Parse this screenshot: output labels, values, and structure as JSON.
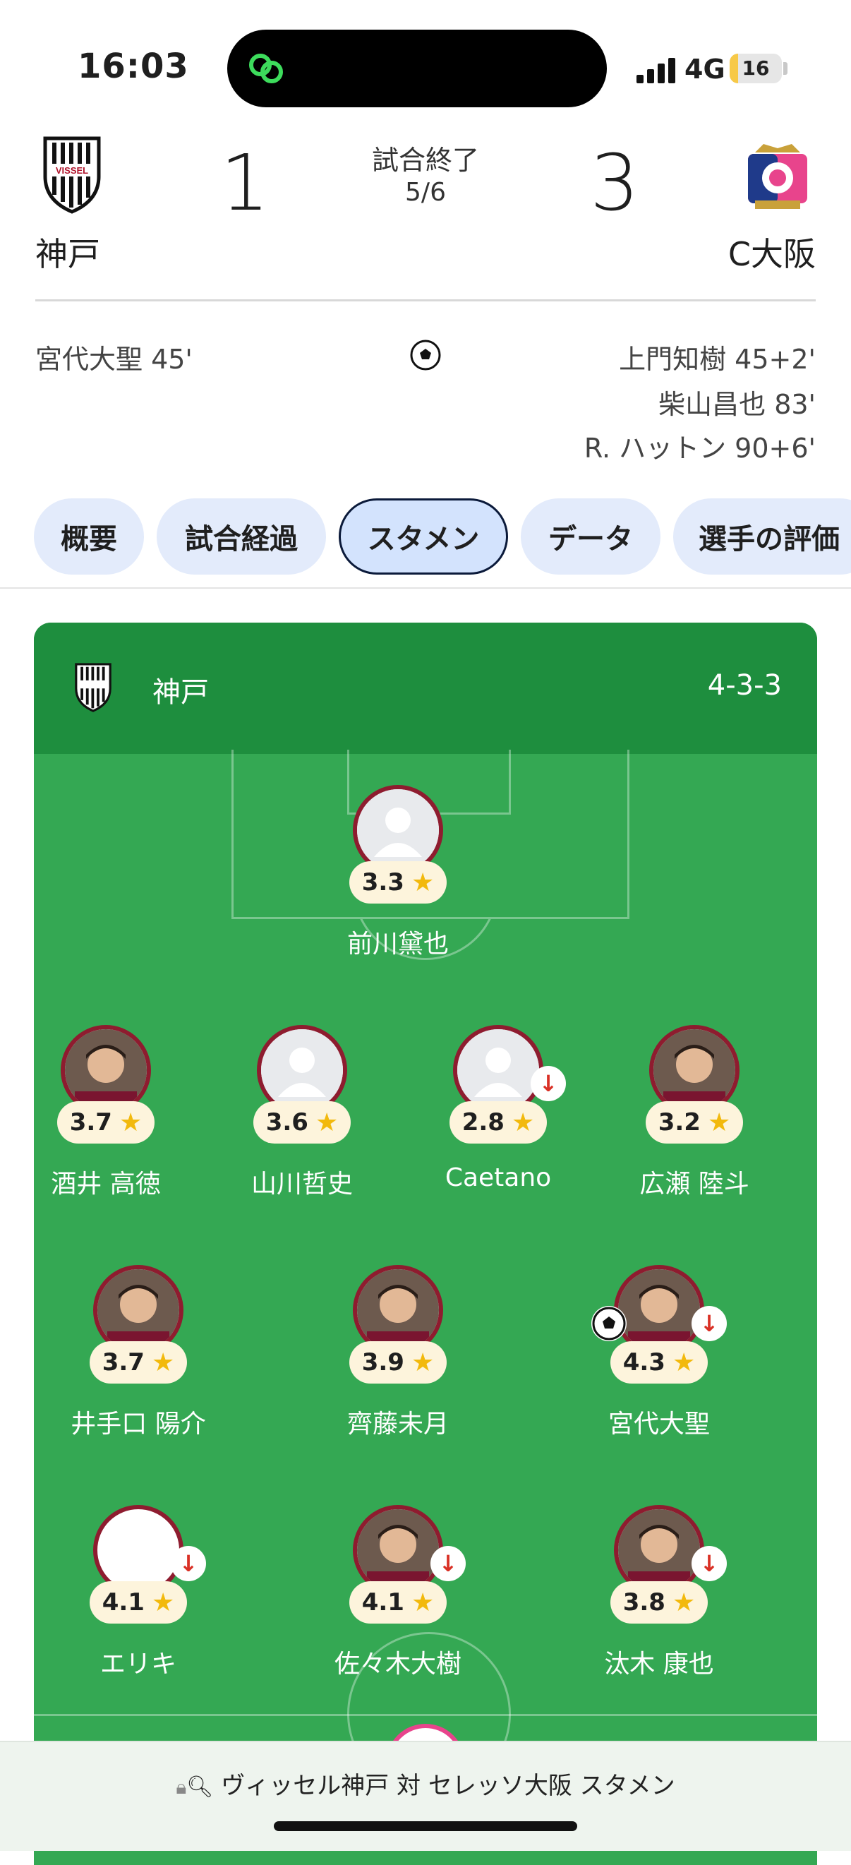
{
  "status_bar": {
    "time": "16:03",
    "network": "4G",
    "battery": "16",
    "battery_level": 0.16
  },
  "match": {
    "home": {
      "name": "神戸",
      "score": "1",
      "crest_text": "VISSEL"
    },
    "away": {
      "name": "C大阪",
      "score": "3"
    },
    "status": "試合終了",
    "date": "5/6",
    "home_scorers": [
      "宮代大聖 45'"
    ],
    "away_scorers": [
      "上門知樹 45+2'",
      "柴山昌也 83'",
      "R. ハットン 90+6'"
    ]
  },
  "tabs": [
    {
      "label": "概要",
      "active": false
    },
    {
      "label": "試合経過",
      "active": false
    },
    {
      "label": "スタメン",
      "active": true
    },
    {
      "label": "データ",
      "active": false
    },
    {
      "label": "選手の評価",
      "active": false
    }
  ],
  "lineup": {
    "team": "神戸",
    "formation": "4-3-3",
    "players": [
      {
        "name": "前川黛也",
        "rating": "3.3",
        "photo": "placeholder",
        "sub": false,
        "goal": false
      },
      {
        "name": "酒井 高徳",
        "rating": "3.7",
        "photo": "photo",
        "sub": false,
        "goal": false
      },
      {
        "name": "山川哲史",
        "rating": "3.6",
        "photo": "placeholder",
        "sub": false,
        "goal": false
      },
      {
        "name": "Caetano",
        "rating": "2.8",
        "photo": "placeholder",
        "sub": true,
        "goal": false
      },
      {
        "name": "広瀬 陸斗",
        "rating": "3.2",
        "photo": "photo",
        "sub": false,
        "goal": false
      },
      {
        "name": "井手口 陽介",
        "rating": "3.7",
        "photo": "photo",
        "sub": false,
        "goal": false
      },
      {
        "name": "齊藤未月",
        "rating": "3.9",
        "photo": "photo",
        "sub": false,
        "goal": false
      },
      {
        "name": "宮代大聖",
        "rating": "4.3",
        "photo": "photo",
        "sub": true,
        "goal": true
      },
      {
        "name": "エリキ",
        "rating": "4.1",
        "photo": "empty",
        "sub": true,
        "goal": false
      },
      {
        "name": "佐々木大樹",
        "rating": "4.1",
        "photo": "photo",
        "sub": true,
        "goal": false
      },
      {
        "name": "汰木 康也",
        "rating": "3.8",
        "photo": "photo",
        "sub": true,
        "goal": false
      }
    ],
    "sub_icon": "down-arrow-icon",
    "goal_icon": "soccer-ball-icon",
    "star_icon": "★"
  },
  "url_bar": {
    "text": "ヴィッセル神戸 対 セレッソ大阪 スタメン"
  },
  "colors": {
    "pitch": "#34a853",
    "pitch_header": "#1e8e3e",
    "avatar_ring": "#8e1c2f",
    "tab_bg": "#e3ebfb",
    "sub_arrow": "#d93025",
    "star": "#f2b90d"
  }
}
